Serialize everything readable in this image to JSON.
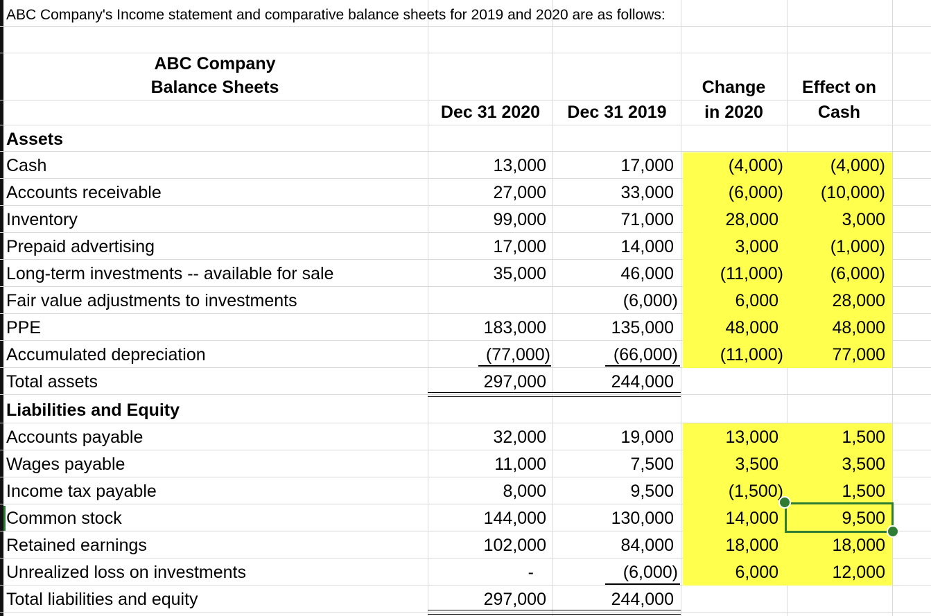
{
  "intro": "ABC Company's Income statement and comparative balance sheets for 2019 and 2020 are as follows:",
  "company": "ABC Company",
  "statement": "Balance Sheets",
  "columns": {
    "dec2020": "Dec 31 2020",
    "dec2019": "Dec 31 2019",
    "change_line1": "Change",
    "change_line2": "in 2020",
    "effect_line1": "Effect on",
    "effect_line2": "Cash"
  },
  "sections": {
    "assets": "Assets",
    "liabilities": "Liabilities and Equity"
  },
  "assets_rows": [
    {
      "label": "Cash",
      "y2020": "13,000",
      "y2019": "17,000",
      "change": "(4,000)",
      "effect": "(4,000)"
    },
    {
      "label": "Accounts receivable",
      "y2020": "27,000",
      "y2019": "33,000",
      "change": "(6,000)",
      "effect": "(10,000)"
    },
    {
      "label": "Inventory",
      "y2020": "99,000",
      "y2019": "71,000",
      "change": "28,000",
      "effect": "3,000"
    },
    {
      "label": "Prepaid advertising",
      "y2020": "17,000",
      "y2019": "14,000",
      "change": "3,000",
      "effect": "(1,000)"
    },
    {
      "label": "Long-term investments -- available for sale",
      "y2020": "35,000",
      "y2019": "46,000",
      "change": "(11,000)",
      "effect": "(6,000)"
    },
    {
      "label": "Fair value adjustments to investments",
      "y2020": "",
      "y2019": "(6,000)",
      "change": "6,000",
      "effect": "28,000"
    },
    {
      "label": "PPE",
      "y2020": "183,000",
      "y2019": "135,000",
      "change": "48,000",
      "effect": "48,000"
    },
    {
      "label": "Accumulated depreciation",
      "y2020": "(77,000)",
      "y2019": "(66,000)",
      "change": "(11,000)",
      "effect": "77,000"
    }
  ],
  "total_assets": {
    "label": "Total assets",
    "y2020": "297,000",
    "y2019": "244,000"
  },
  "liab_rows": [
    {
      "label": "Accounts payable",
      "y2020": "32,000",
      "y2019": "19,000",
      "change": "13,000",
      "effect": "1,500"
    },
    {
      "label": "Wages payable",
      "y2020": "11,000",
      "y2019": "7,500",
      "change": "3,500",
      "effect": "3,500"
    },
    {
      "label": "Income tax payable",
      "y2020": "8,000",
      "y2019": "9,500",
      "change": "(1,500)",
      "effect": "1,500"
    },
    {
      "label": "Common stock",
      "y2020": "144,000",
      "y2019": "130,000",
      "change": "14,000",
      "effect": "9,500"
    },
    {
      "label": "Retained earnings",
      "y2020": "102,000",
      "y2019": "84,000",
      "change": "18,000",
      "effect": "18,000"
    },
    {
      "label": "Unrealized loss on investments",
      "y2020": "-",
      "y2019": "(6,000)",
      "change": "6,000",
      "effect": "12,000"
    }
  ],
  "total_liab": {
    "label": "Total liabilities and equity",
    "y2020": "297,000",
    "y2019": "244,000"
  },
  "colors": {
    "highlight": "#ffff4d",
    "selection": "#2e7d32",
    "grid": "#d9d9d9"
  }
}
